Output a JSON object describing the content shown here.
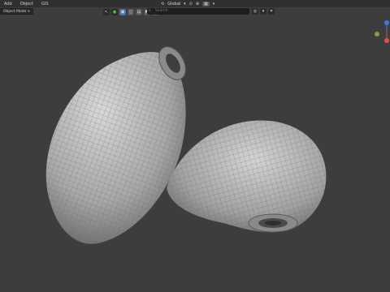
{
  "menubar": {
    "items": [
      "Add",
      "Object",
      "GIS"
    ]
  },
  "header": {
    "mode_label": "Object Mode ∨",
    "transform_orientation": "Global",
    "search_placeholder": "Search"
  },
  "colors": {
    "viewport_bg": "#3d3d3d",
    "axis_x": "#e0504a",
    "axis_y": "#7fa63a",
    "axis_z": "#3b7cd9",
    "active_tool": "#4772b3"
  },
  "icons": [
    "cursor-icon",
    "circle-icon",
    "select-box-icon",
    "select-circle-icon",
    "magnet-icon",
    "search-icon",
    "filter-icon",
    "globe-icon"
  ]
}
